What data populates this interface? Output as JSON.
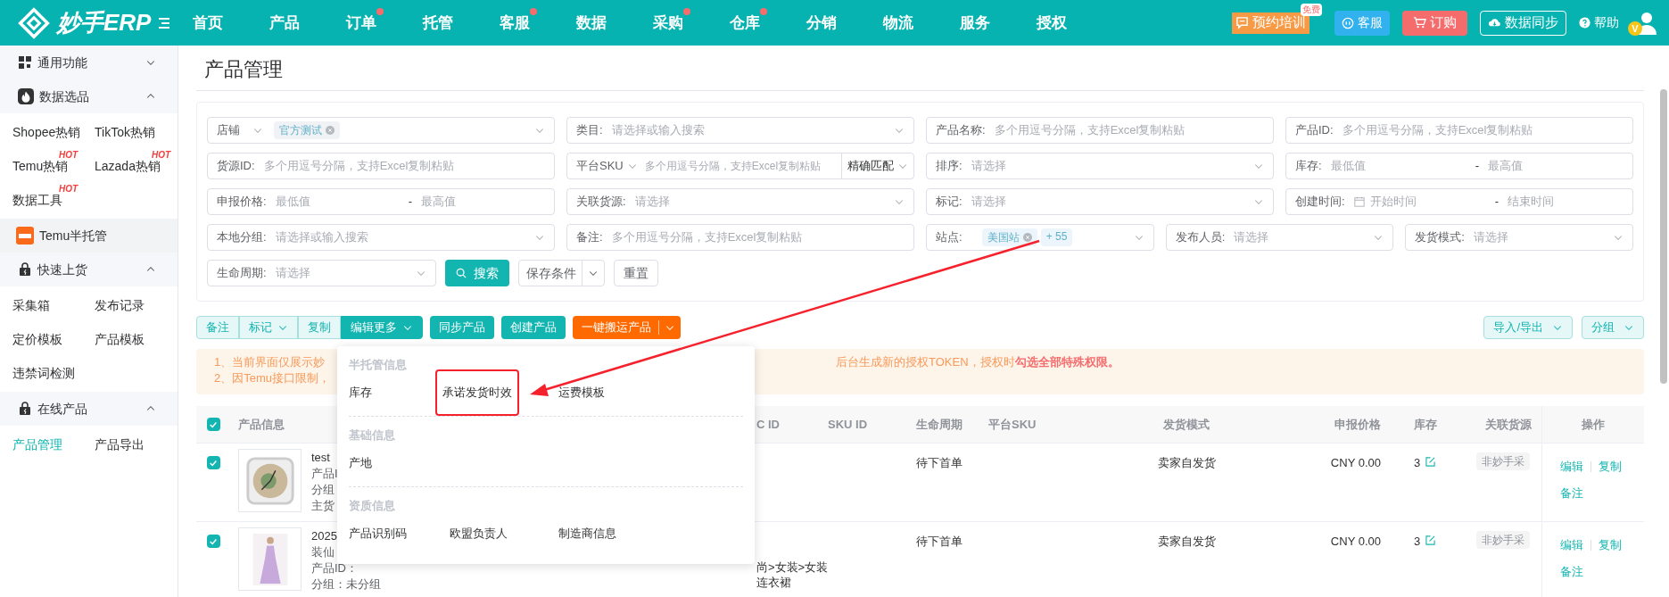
{
  "top_nav": {
    "logo": "妙手ERP",
    "menu": [
      {
        "label": "首页",
        "dot": false
      },
      {
        "label": "产品",
        "dot": false
      },
      {
        "label": "订单",
        "dot": true
      },
      {
        "label": "托管",
        "dot": false
      },
      {
        "label": "客服",
        "dot": true
      },
      {
        "label": "数据",
        "dot": false
      },
      {
        "label": "采购",
        "dot": true
      },
      {
        "label": "仓库",
        "dot": true
      },
      {
        "label": "分销",
        "dot": false
      },
      {
        "label": "物流",
        "dot": false
      },
      {
        "label": "服务",
        "dot": false
      },
      {
        "label": "授权",
        "dot": false
      }
    ],
    "training": {
      "label": "预约培训",
      "tag": "免费"
    },
    "service": "客服",
    "order": "订购",
    "sync": "数据同步",
    "help": "帮助",
    "avatar_badge": "V"
  },
  "sidebar": [
    {
      "kind": "group",
      "label": "通用功能",
      "expanded": false
    },
    {
      "kind": "group",
      "label": "数据选品",
      "expanded": true,
      "items": [
        {
          "label": "Shopee热销",
          "selected": false
        },
        {
          "label": "TikTok热销",
          "selected": false
        },
        {
          "label": "Temu热销",
          "badge": "HOT",
          "selected": false
        },
        {
          "label": "Lazada热销",
          "badge": "HOT",
          "selected": false
        },
        {
          "label": "数据工具",
          "badge": "HOT",
          "selected": false
        }
      ]
    },
    {
      "kind": "link",
      "label": "Temu半托管",
      "highlighted": true
    },
    {
      "kind": "group",
      "label": "快速上货",
      "expanded": true,
      "items": [
        {
          "label": "采集箱",
          "selected": false
        },
        {
          "label": "发布记录",
          "selected": false
        },
        {
          "label": "定价模板",
          "selected": false
        },
        {
          "label": "产品模板",
          "selected": false
        },
        {
          "label": "违禁词检测",
          "selected": false
        }
      ]
    },
    {
      "kind": "group",
      "label": "在线产品",
      "expanded": true,
      "items": [
        {
          "label": "产品管理",
          "selected": true
        },
        {
          "label": "产品导出",
          "selected": false
        }
      ]
    }
  ],
  "page_title": "产品管理",
  "filters": {
    "rows": [
      [
        {
          "kind": "shop",
          "label": "店铺",
          "tags": [
            "官方测试"
          ]
        },
        {
          "kind": "select",
          "label": "类目:",
          "placeholder": "请选择或输入搜索"
        },
        {
          "kind": "input",
          "label": "产品名称:",
          "placeholder": "多个用逗号分隔，支持Excel复制粘贴"
        },
        {
          "kind": "input",
          "label": "产品ID:",
          "placeholder": "多个用逗号分隔，支持Excel复制粘贴"
        }
      ],
      [
        {
          "kind": "input",
          "label": "货源ID:",
          "placeholder": "多个用逗号分隔，支持Excel复制粘贴"
        },
        {
          "kind": "sku",
          "label": "平台SKU",
          "placeholder": "多个用逗号分隔，支持Excel复制粘贴",
          "mode": "精确匹配"
        },
        {
          "kind": "select",
          "label": "排序:",
          "placeholder": "请选择"
        },
        {
          "kind": "range",
          "label": "库存:",
          "from": {
            "placeholder": "最低值"
          },
          "separator": "-",
          "to": {
            "placeholder": "最高值"
          }
        }
      ],
      [
        {
          "kind": "range",
          "label": "申报价格:",
          "from": {
            "placeholder": "最低值"
          },
          "separator": "-",
          "to": {
            "placeholder": "最高值"
          }
        },
        {
          "kind": "select",
          "label": "关联货源:",
          "placeholder": "请选择"
        },
        {
          "kind": "select",
          "label": "标记:",
          "placeholder": "请选择"
        },
        {
          "kind": "date_range",
          "label": "创建时间:",
          "from": {
            "placeholder": "开始时间"
          },
          "separator": "-",
          "to": {
            "placeholder": "结束时间"
          }
        }
      ],
      [
        {
          "kind": "select",
          "label": "本地分组:",
          "placeholder": "请选择或输入搜索"
        },
        {
          "kind": "input",
          "label": "备注:",
          "placeholder": "多个用逗号分隔，支持Excel复制粘贴"
        },
        {
          "kind": "tags",
          "label": "站点:",
          "tags": [
            "美国站"
          ],
          "more": "+ 55"
        },
        {
          "kind": "select",
          "label": "发布人员:",
          "placeholder": "请选择"
        },
        {
          "kind": "select",
          "label": "发货模式:",
          "placeholder": "请选择"
        }
      ]
    ],
    "lifecycle": {
      "label": "生命周期:",
      "placeholder": "请选择"
    },
    "search": "搜索",
    "save": "保存条件",
    "reset": "重置"
  },
  "toolbar": {
    "group": [
      {
        "label": "备注",
        "caret": false,
        "active": false
      },
      {
        "label": "标记",
        "caret": true,
        "active": false
      },
      {
        "label": "复制",
        "caret": false,
        "active": false
      },
      {
        "label": "编辑更多",
        "caret": true,
        "active": true
      }
    ],
    "sync": "同步产品",
    "create": "创建产品",
    "move": "一键搬运产品",
    "import_export": "导入/导出",
    "group_btn": "分组"
  },
  "notice": {
    "line_1_start": "1、当前界面仅展示妙",
    "line_1_end": "后台生成新的授权TOKEN，授权时**勾选全部特殊权限。**",
    "line_2_start": "2、因Temu接口限制，"
  },
  "table": {
    "select_all": true,
    "columns": [
      "产品信息",
      "C ID",
      "SKU ID",
      "生命周期",
      "平台SKU",
      "发货模式",
      "申报价格",
      "库存",
      "关联货源",
      "操作"
    ],
    "rows": [
      {
        "checked": true,
        "kind": "clock",
        "info": [
          "test",
          "产品I",
          "分组",
          "主货"
        ],
        "lifecycle": "待下首单",
        "ship_mode": "卖家自发货",
        "price": "CNY 0.00",
        "stock": "3",
        "source": "非妙手采",
        "actions": [
          "编辑",
          "复制",
          "备注"
        ]
      },
      {
        "checked": true,
        "kind": "dress",
        "info": [
          "2025",
          "装仙",
          "产品ID：",
          "分组：未分组"
        ],
        "category": [
          "尚>女装>女装",
          "连衣裙"
        ],
        "lifecycle": "待下首单",
        "ship_mode": "卖家自发货",
        "price": "CNY 0.00",
        "stock": "3",
        "source": "非妙手采",
        "actions": [
          "编辑",
          "复制",
          "备注"
        ]
      }
    ]
  },
  "edit_more_menu": [
    {
      "title": "半托管信息",
      "items": [
        {
          "label": "库存",
          "highlighted": false
        },
        {
          "label": "承诺发货时效",
          "highlighted": true
        },
        {
          "label": "运费模板",
          "highlighted": false
        }
      ]
    },
    {
      "title": "基础信息",
      "items": [
        {
          "label": "产地",
          "highlighted": false
        }
      ]
    },
    {
      "title": "资质信息",
      "items": [
        {
          "label": "产品识别码",
          "highlighted": false
        },
        {
          "label": "欧盟负责人",
          "highlighted": false
        },
        {
          "label": "制造商信息",
          "highlighted": false
        }
      ]
    }
  ]
}
